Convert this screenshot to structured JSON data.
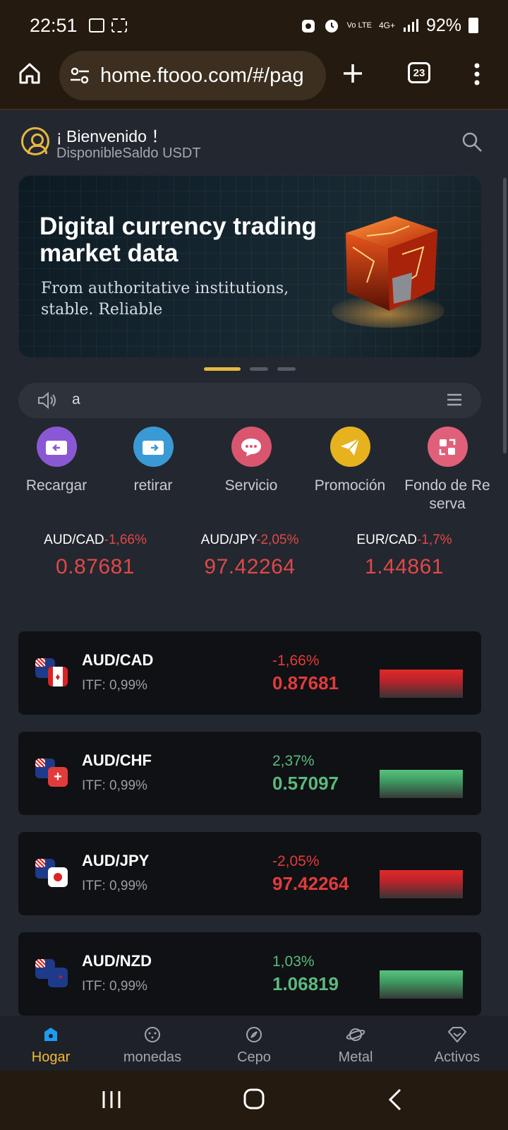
{
  "status_bar": {
    "time": "22:51",
    "network_vo": "Vo LTE",
    "network_4g": "4G+",
    "battery": "92%",
    "icons": [
      "gallery-icon",
      "grid-icon",
      "hand-icon",
      "alarm-icon",
      "signal-icon",
      "battery-icon"
    ]
  },
  "browser": {
    "url": "home.ftooo.com/#/pag",
    "tab_count": "23",
    "icons": [
      "home-icon",
      "site-settings-icon",
      "new-tab-icon",
      "tabs-icon",
      "more-icon"
    ]
  },
  "header": {
    "welcome": "¡ Bienvenido ！",
    "balance_label": "DisponibleSaldo USDT"
  },
  "banner": {
    "title": "Digital currency trading market data",
    "subtitle": "From authoritative institutions, stable. Reliable",
    "page_indicator": {
      "active": 1,
      "total": 3
    }
  },
  "notice": {
    "text": "a"
  },
  "actions": [
    {
      "label": "Recargar",
      "icon": "wallet-in-icon",
      "color": "#8a58d4"
    },
    {
      "label": "retirar",
      "icon": "wallet-out-icon",
      "color": "#3a9ad6"
    },
    {
      "label": "Servicio",
      "icon": "chat-icon",
      "color": "#d9566e"
    },
    {
      "label": "Promoción",
      "icon": "send-icon",
      "color": "#e6b21e"
    },
    {
      "label": "Fondo de Re serva",
      "icon": "swap-icon",
      "color": "#e0607a"
    }
  ],
  "tickers": [
    {
      "pair": "AUD/CAD",
      "change": "-1,66%",
      "price": "0.87681"
    },
    {
      "pair": "AUD/JPY",
      "change": "-2,05%",
      "price": "97.42264"
    },
    {
      "pair": "EUR/CAD",
      "change": "-1,7%",
      "price": "1.44861"
    }
  ],
  "markets": [
    {
      "pair": "AUD/CAD",
      "itf": "ITF: 0,99%",
      "change": "-1,66%",
      "price": "0.87681",
      "trend": "down"
    },
    {
      "pair": "AUD/CHF",
      "itf": "ITF: 0,99%",
      "change": "2,37%",
      "price": "0.57097",
      "trend": "up"
    },
    {
      "pair": "AUD/JPY",
      "itf": "ITF: 0,99%",
      "change": "-2,05%",
      "price": "97.42264",
      "trend": "down"
    },
    {
      "pair": "AUD/NZD",
      "itf": "ITF: 0,99%",
      "change": "1,03%",
      "price": "1.06819",
      "trend": "up"
    }
  ],
  "bottom_nav": [
    {
      "label": "Hogar",
      "icon": "home-icon",
      "active": true
    },
    {
      "label": "monedas",
      "icon": "coins-icon",
      "active": false
    },
    {
      "label": "Cepo",
      "icon": "compass-icon",
      "active": false
    },
    {
      "label": "Metal",
      "icon": "planet-icon",
      "active": false
    },
    {
      "label": "Activos",
      "icon": "diamond-icon",
      "active": false
    }
  ],
  "colors": {
    "accent": "#f2b934",
    "down": "#e23b3b",
    "up": "#5cb97d",
    "background": "#23272f",
    "card": "#0f1114"
  }
}
